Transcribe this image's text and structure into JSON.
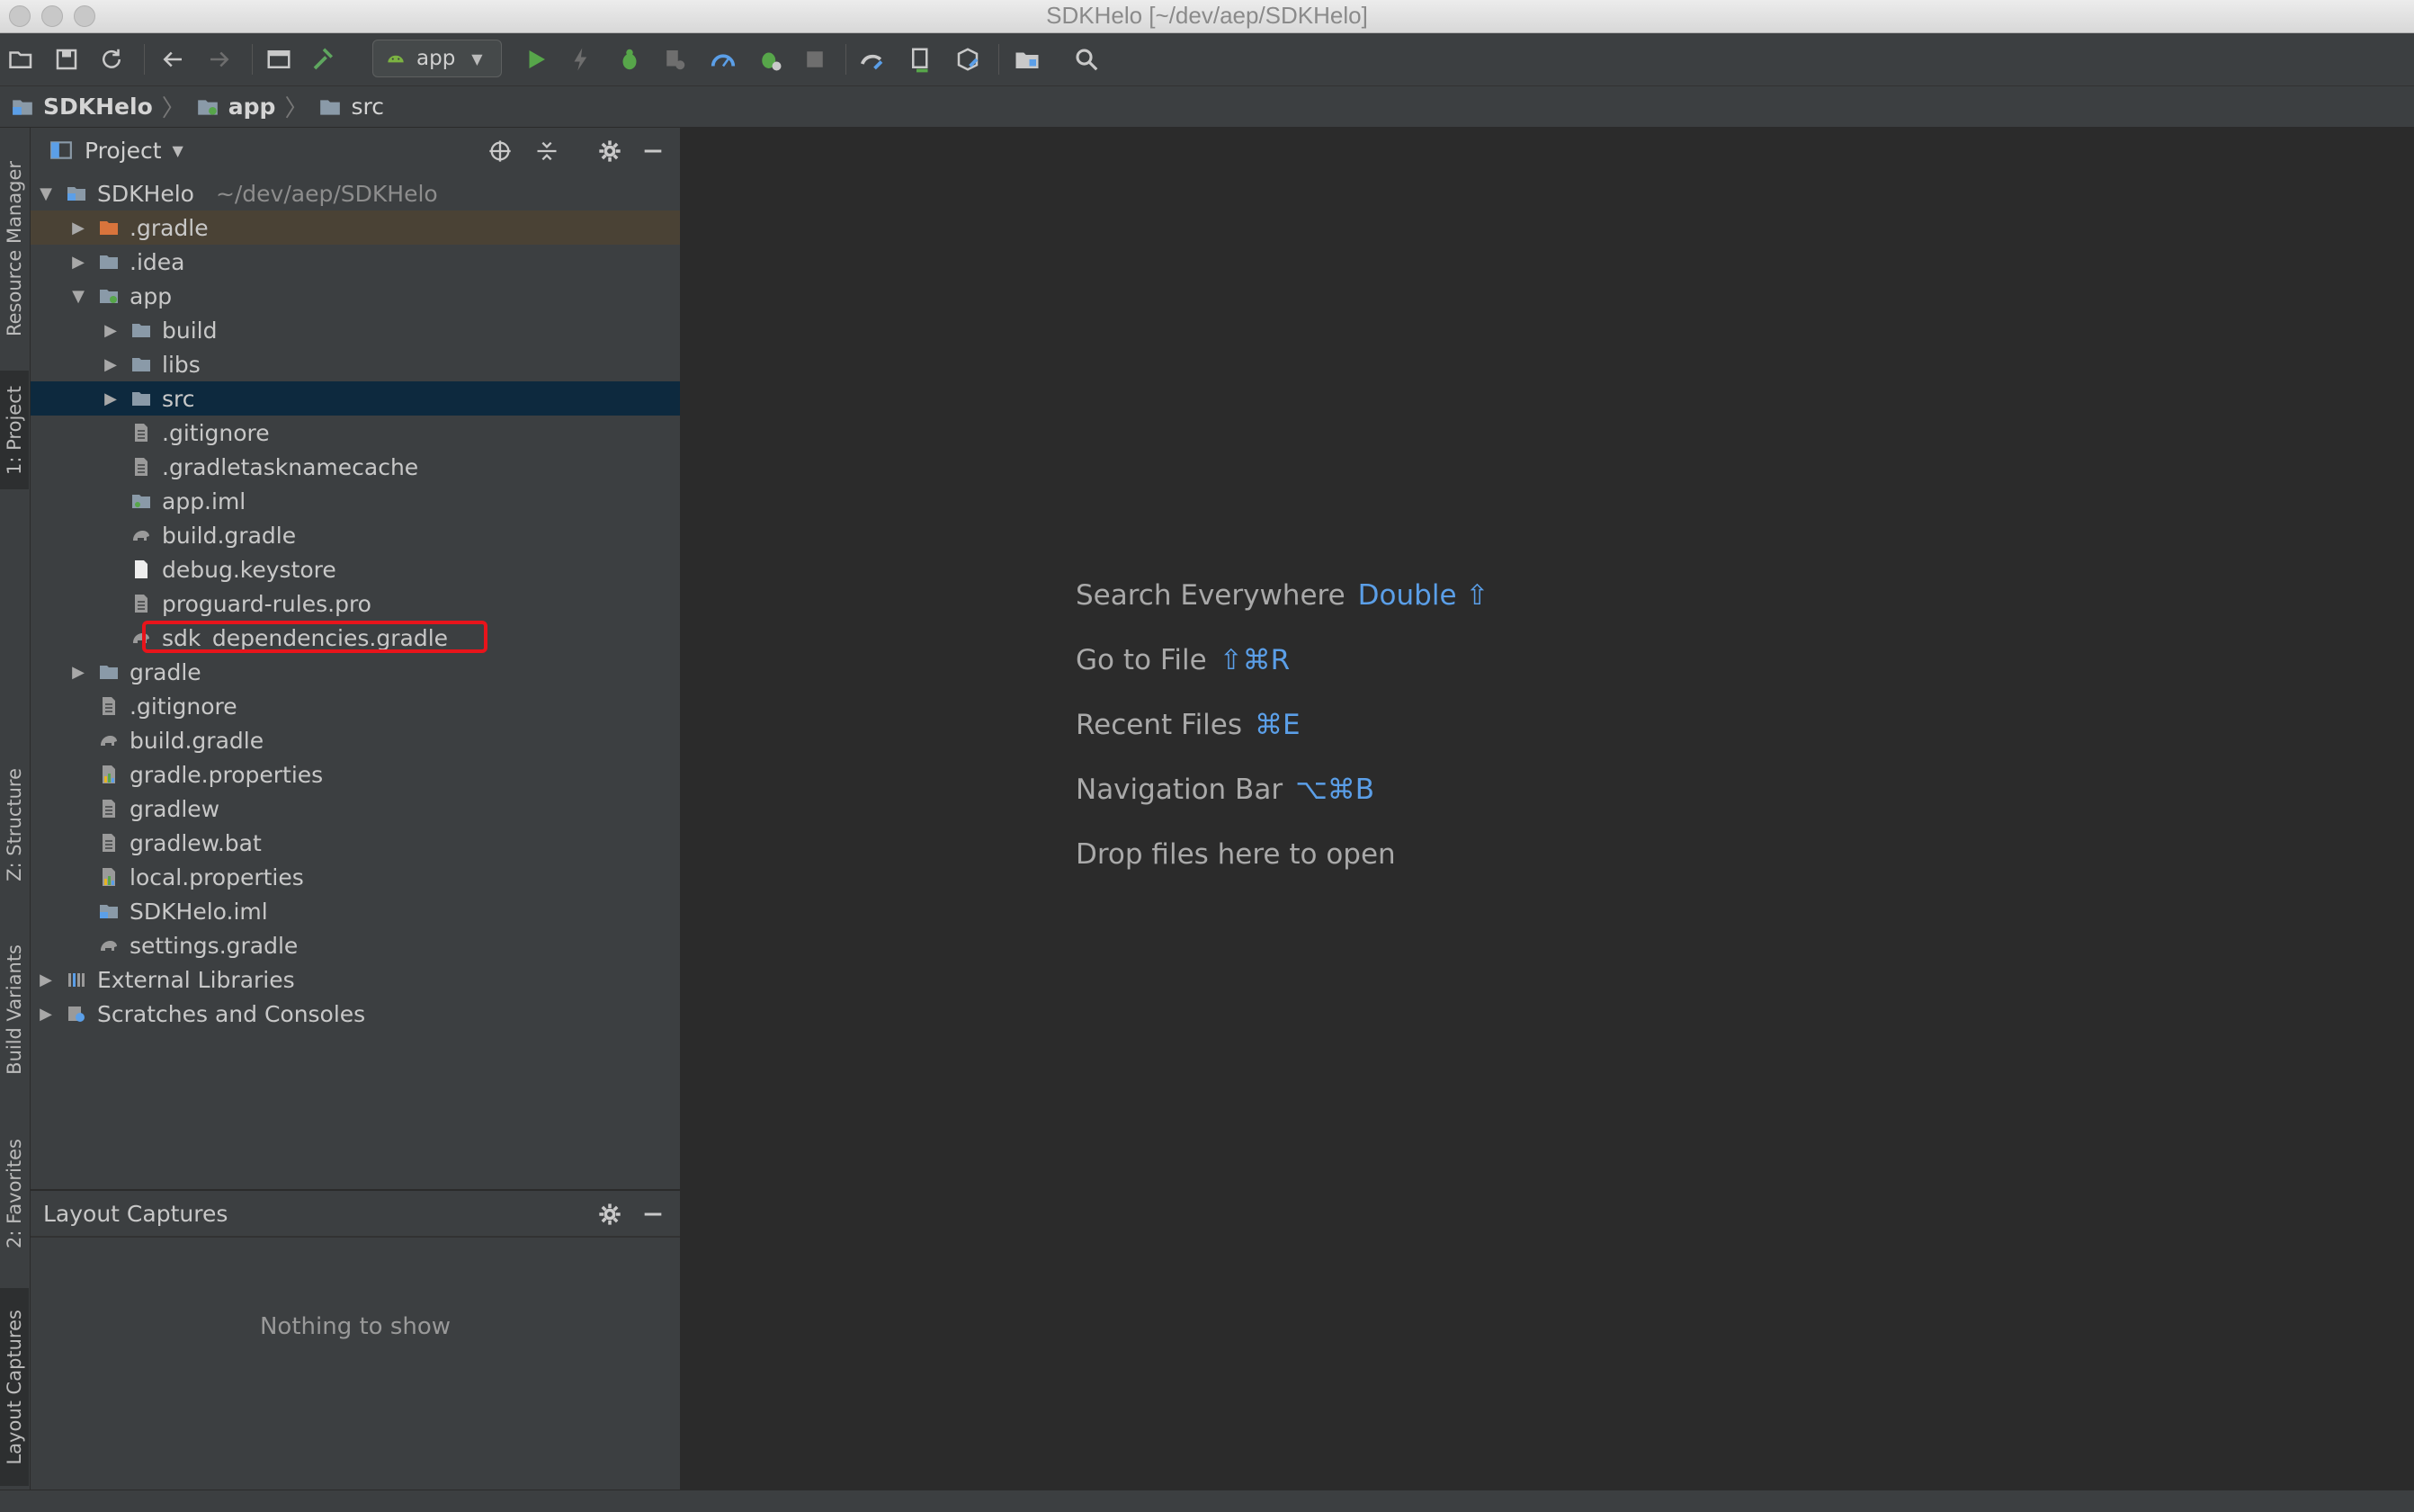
{
  "window": {
    "title": "SDKHelo [~/dev/aep/SDKHelo]"
  },
  "toolbar": {
    "run_config": "app"
  },
  "navbar": {
    "crumbs": [
      "SDKHelo",
      "app",
      "src"
    ]
  },
  "left_stripe": {
    "resource_manager": "Resource Manager",
    "project": "1: Project",
    "structure": "Z: Structure",
    "build_variants": "Build Variants",
    "favorites": "2: Favorites",
    "layout_captures": "Layout Captures"
  },
  "project_panel": {
    "title": "Project",
    "tree": [
      {
        "label": "SDKHelo",
        "path": "~/dev/aep/SDKHelo"
      },
      {
        "label": ".gradle"
      },
      {
        "label": ".idea"
      },
      {
        "label": "app"
      },
      {
        "label": "build"
      },
      {
        "label": "libs"
      },
      {
        "label": "src"
      },
      {
        "label": ".gitignore"
      },
      {
        "label": ".gradletasknamecache"
      },
      {
        "label": "app.iml"
      },
      {
        "label": "build.gradle"
      },
      {
        "label": "debug.keystore"
      },
      {
        "label": "proguard-rules.pro"
      },
      {
        "label": "sdk_dependencies.gradle"
      },
      {
        "label": "gradle"
      },
      {
        "label": ".gitignore"
      },
      {
        "label": "build.gradle"
      },
      {
        "label": "gradle.properties"
      },
      {
        "label": "gradlew"
      },
      {
        "label": "gradlew.bat"
      },
      {
        "label": "local.properties"
      },
      {
        "label": "SDKHelo.iml"
      },
      {
        "label": "settings.gradle"
      },
      {
        "label": "External Libraries"
      },
      {
        "label": "Scratches and Consoles"
      }
    ]
  },
  "layout_captures": {
    "title": "Layout Captures",
    "empty": "Nothing to show"
  },
  "welcome": {
    "hints": [
      {
        "label": "Search Everywhere",
        "key": "Double ⇧"
      },
      {
        "label": "Go to File",
        "key": "⇧⌘R"
      },
      {
        "label": "Recent Files",
        "key": "⌘E"
      },
      {
        "label": "Navigation Bar",
        "key": "⌥⌘B"
      },
      {
        "label": "Drop files here to open",
        "key": ""
      }
    ]
  },
  "colors": {
    "accent": "#5b9fe8",
    "selection": "#0d293e",
    "highlight_box": "#e8141b"
  }
}
